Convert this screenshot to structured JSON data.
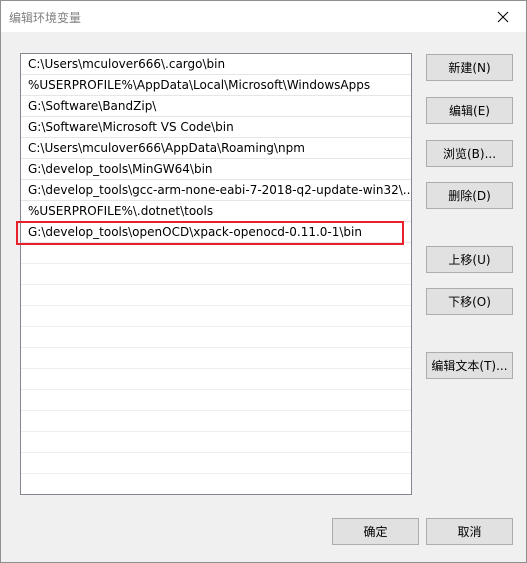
{
  "window": {
    "title": "编辑环境变量"
  },
  "paths": [
    "C:\\Users\\mculover666\\.cargo\\bin",
    "%USERPROFILE%\\AppData\\Local\\Microsoft\\WindowsApps",
    "G:\\Software\\BandZip\\",
    "G:\\Software\\Microsoft VS Code\\bin",
    "C:\\Users\\mculover666\\AppData\\Roaming\\npm",
    "G:\\develop_tools\\MinGW64\\bin",
    "G:\\develop_tools\\gcc-arm-none-eabi-7-2018-q2-update-win32\\...",
    "%USERPROFILE%\\.dotnet\\tools",
    "G:\\develop_tools\\openOCD\\xpack-openocd-0.11.0-1\\bin"
  ],
  "buttons": {
    "new": "新建(N)",
    "edit": "编辑(E)",
    "browse": "浏览(B)...",
    "delete": "删除(D)",
    "move_up": "上移(U)",
    "move_down": "下移(O)",
    "edit_text": "编辑文本(T)...",
    "ok": "确定",
    "cancel": "取消"
  },
  "colors": {
    "highlight_border": "#e8202a"
  }
}
